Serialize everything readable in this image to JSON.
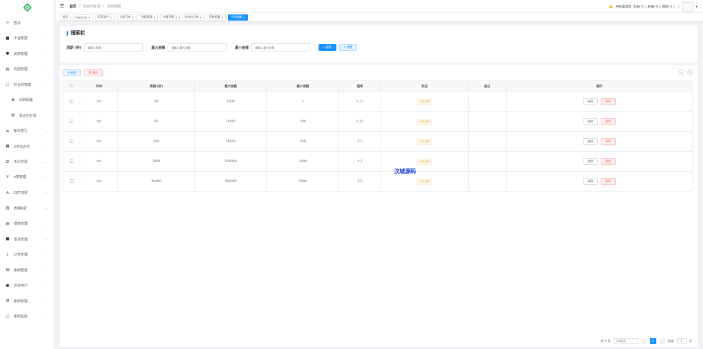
{
  "brand": {
    "color": "#3bb26a",
    "accent": "#1890ff"
  },
  "sidebar": {
    "items": [
      {
        "label": "首页",
        "icon": "home-icon",
        "glyph": "⌂"
      },
      {
        "label": "平台数据",
        "icon": "chart-icon",
        "glyph": "■",
        "chev": "⌄"
      },
      {
        "label": "玩家管理",
        "icon": "user-icon",
        "glyph": "●",
        "chev": "⌄"
      },
      {
        "label": "充提管理",
        "icon": "document-icon",
        "glyph": "▤",
        "chev": "⌄"
      },
      {
        "label": "秒合约管理",
        "icon": "monitor-icon",
        "glyph": "▢",
        "chev": "⌃"
      },
      {
        "label": "币种配置",
        "icon": "gear-icon",
        "glyph": "✿",
        "sub": true
      },
      {
        "label": "秒合约订单",
        "icon": "document-icon",
        "glyph": "▤",
        "sub": true
      },
      {
        "label": "新币发行",
        "icon": "tag-icon",
        "glyph": "≡",
        "chev": "⌄"
      },
      {
        "label": "U本位合约",
        "icon": "grid-icon",
        "glyph": "▦",
        "chev": "⌄"
      },
      {
        "label": "币币交易",
        "icon": "list-icon",
        "glyph": "☰",
        "chev": "⌄"
      },
      {
        "label": "ក搞管理",
        "icon": "yen-icon",
        "glyph": "¥",
        "chev": "⌄"
      },
      {
        "label": "DEFI挖矿",
        "icon": "person-icon",
        "glyph": "A",
        "chev": "⌄"
      },
      {
        "label": "质押挖矿",
        "icon": "bar-chart-icon",
        "glyph": "▥",
        "chev": "⌄"
      },
      {
        "label": "理财管理",
        "icon": "document-icon",
        "glyph": "▤",
        "chev": "⌄"
      },
      {
        "label": "借贷管理",
        "icon": "book-icon",
        "glyph": "■",
        "chev": "⌄"
      },
      {
        "label": "公告管理",
        "icon": "notice-icon",
        "glyph": "▯",
        "chev": "⌄"
      },
      {
        "label": "系统配置",
        "icon": "document-icon",
        "glyph": "▤",
        "chev": "⌄"
      },
      {
        "label": "后台用户",
        "icon": "user-icon",
        "glyph": "●",
        "chev": "⌄"
      },
      {
        "label": "系统管理",
        "icon": "gear-icon",
        "glyph": "✿",
        "chev": "⌄"
      },
      {
        "label": "系统监控",
        "icon": "monitor-icon",
        "glyph": "▢",
        "chev": "⌄"
      }
    ]
  },
  "header": {
    "breadcrumb": [
      "首页",
      "秒合约管理",
      "币种周期"
    ],
    "sep": "/",
    "notice": "待处理消息: 实名( 0 ), 充值( 0 ), 提现( 0 )",
    "fullscreen": "⛶",
    "dropdown": "▾"
  },
  "tags": [
    "首页",
    "featured",
    "玩家用户",
    "立即订单",
    "授权管理",
    "充值列表",
    "秒合约订单",
    "币种配置",
    "币种周期"
  ],
  "search": {
    "title": "搜索栏",
    "fields": [
      {
        "label": "周期 (秒)",
        "placeholder": "请输入周期"
      },
      {
        "label": "最大金额",
        "placeholder": "请输入最大金额"
      },
      {
        "label": "最小金额",
        "placeholder": "请输入最小金额"
      }
    ],
    "search_btn": "⌕ 搜索",
    "reset_btn": "↻ 重置"
  },
  "toolbar": {
    "add": "+ 新增",
    "delete": "🗑 删除"
  },
  "table": {
    "columns": [
      "币种",
      "周期 (秒)",
      "最大金额",
      "最小金额",
      "赔率",
      "状态",
      "备注",
      "操作"
    ],
    "rows": [
      {
        "coin": "btc",
        "period": "30",
        "max": "1000",
        "min": "1",
        "odds": "0.12",
        "status": "平台全部",
        "remark": ""
      },
      {
        "coin": "btc",
        "period": "60",
        "max": "10000",
        "min": "100",
        "odds": "0.15",
        "status": "平台全部",
        "remark": ""
      },
      {
        "coin": "btc",
        "period": "300",
        "max": "50000",
        "min": "500",
        "odds": "0.2",
        "status": "平台全部",
        "remark": ""
      },
      {
        "coin": "btc",
        "period": "3600",
        "max": "100000",
        "min": "1000",
        "odds": "0.3",
        "status": "平台全部",
        "remark": ""
      },
      {
        "coin": "btc",
        "period": "86400",
        "max": "500000",
        "min": "5000",
        "odds": "0.5",
        "status": "平台全部",
        "remark": ""
      }
    ],
    "edit": "修改",
    "remove": "删除"
  },
  "watermark": "汉城源码",
  "pagination": {
    "total": "共 5 条",
    "page_size": "10条/页",
    "prev": "‹",
    "page": "1",
    "next": "›",
    "goto": "前往",
    "goto_value": "1",
    "unit": "页"
  }
}
